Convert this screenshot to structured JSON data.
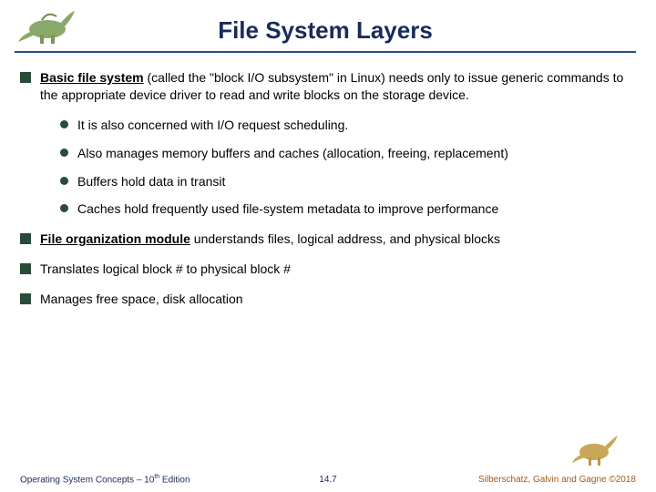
{
  "title": "File System Layers",
  "bullets": [
    {
      "lead": "Basic file system",
      "rest": " (called the \"block I/O subsystem\" in Linux) needs only to issue generic commands to the appropriate device driver to read and write blocks on the storage device.",
      "sub": [
        "It is also concerned with I/O request scheduling.",
        "Also manages memory buffers and caches (allocation, freeing, replacement)",
        "Buffers hold data in transit",
        "Caches hold frequently used file-system metadata to improve performance"
      ]
    },
    {
      "lead": "File organization module",
      "rest": " understands files, logical address, and physical blocks",
      "sub": []
    },
    {
      "plain": "Translates logical block # to physical block #"
    },
    {
      "plain": "Manages free space, disk allocation"
    }
  ],
  "footer": {
    "left_a": "Operating System Concepts – 10",
    "left_b": " Edition",
    "left_sup": "th",
    "center": "14.7",
    "right": "Silberschatz, Galvin and Gagne ©2018"
  }
}
